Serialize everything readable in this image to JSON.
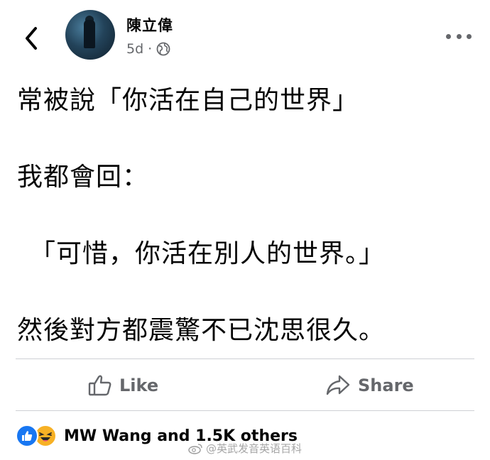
{
  "header": {
    "author_name": "陳立偉",
    "timestamp": "5d",
    "separator": "·",
    "privacy_icon": "globe-icon",
    "back_icon": "chevron-left-icon",
    "more_icon": "more-horizontal-icon"
  },
  "post": {
    "lines": [
      "常被說「你活在自己的世界」",
      "我都會回：",
      "「可惜，你活在別人的世界。」",
      "然後對方都震驚不已沈思很久。"
    ]
  },
  "actions": {
    "like_label": "Like",
    "share_label": "Share"
  },
  "reactions": {
    "summary": "MW Wang and 1.5K others"
  },
  "watermark": {
    "text": "@英武发音英语百科"
  },
  "colors": {
    "facebook_blue": "#1877f2",
    "secondary_text": "#65676b",
    "haha_yellow": "#f7b125"
  }
}
